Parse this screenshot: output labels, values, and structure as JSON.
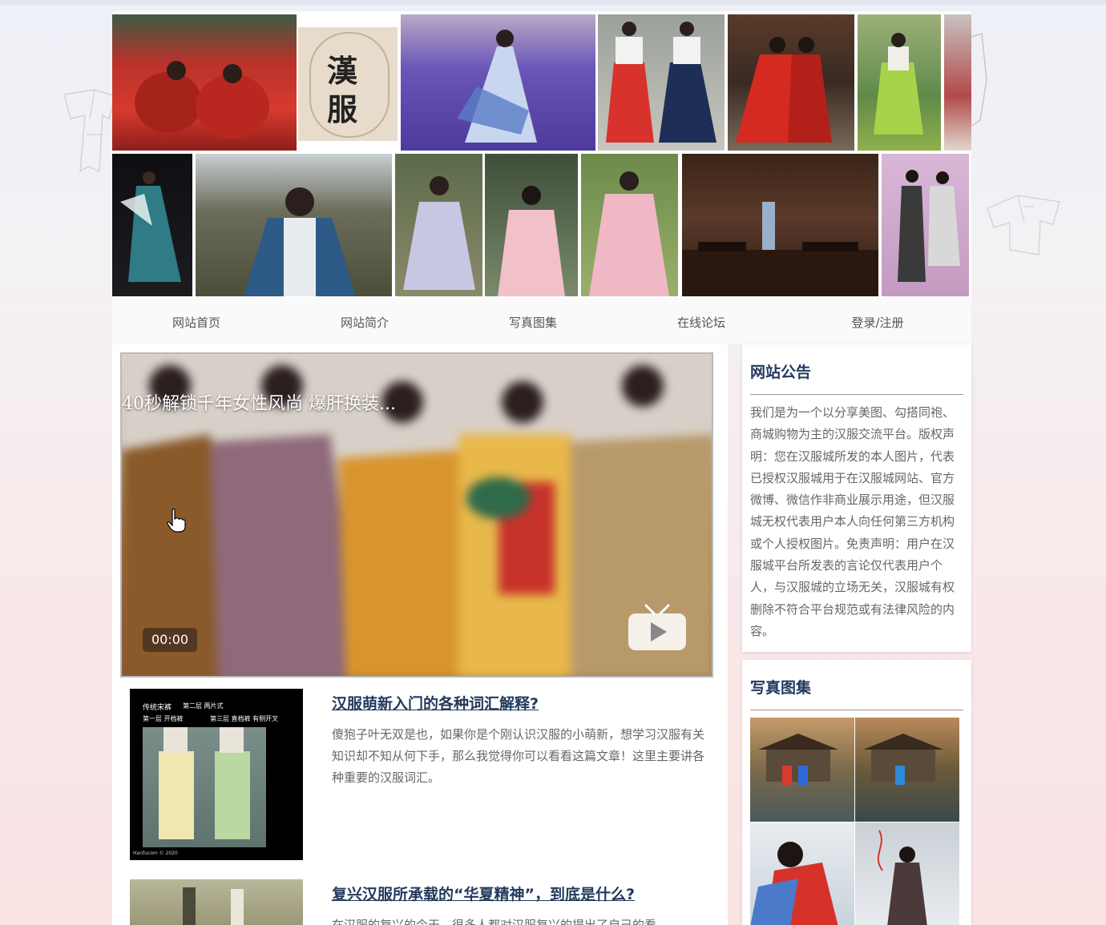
{
  "nav": {
    "items": [
      "网站首页",
      "网站简介",
      "写真图集",
      "在线论坛",
      "登录/注册"
    ]
  },
  "banner": {
    "logo_text": [
      "漢",
      "服"
    ]
  },
  "video": {
    "title": "40秒解锁千年女性风尚 爆肝换装...",
    "time": "00:00"
  },
  "articles": [
    {
      "title": "汉服萌新入门的各种词汇解释?",
      "summary": "傻狍子叶无双是也，如果你是个刚认识汉服的小萌新，想学习汉服有关知识却不知从何下手，那么我觉得你可以看看这篇文章！这里主要讲各种重要的汉服词汇。",
      "thumb_labels": [
        "传统宋裤",
        "第二层 两片式",
        "第一层 开档裤",
        "第三层 直档裤 有侧开叉",
        "Hanfucom © 2020"
      ]
    },
    {
      "title": "复兴汉服所承载的“华夏精神”，到底是什么?",
      "summary": "在汉服的复兴的今天，很多人都对汉服复兴的提出了自己的看"
    }
  ],
  "sidebar": {
    "notice": {
      "title": "网站公告",
      "text": "我们是为一个以分享美图、勾搭同袍、商城购物为主的汉服交流平台。版权声明：您在汉服城所发的本人图片，代表已授权汉服城用于在汉服城网站、官方微博、微信作非商业展示用途，但汉服城无权代表用户本人向任何第三方机构或个人授权图片。免责声明：用户在汉服城平台所发表的言论仅代表用户个人，与汉服城的立场无关，汉服城有权删除不符合平台规范或有法律风险的内容。"
    },
    "gallery": {
      "title": "写真图集"
    }
  },
  "colors": {
    "heading": "#233a5e",
    "body_text": "#666666",
    "nav_text": "#555555"
  }
}
